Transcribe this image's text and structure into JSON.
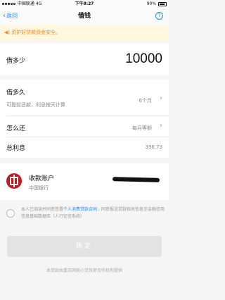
{
  "status_bar": {
    "carrier": "中国联通",
    "network": "4G",
    "time": "下午8:27",
    "battery": "90%",
    "battery_level": 0.9
  },
  "nav": {
    "back_label": "返回",
    "title": "借钱",
    "help_label": "?"
  },
  "notice": "资护好贷款资金安全。",
  "amount": {
    "label": "借多少",
    "value": "10000"
  },
  "duration": {
    "label": "借多久",
    "hint": "可提前还款，利息按天计算",
    "value": "6个月"
  },
  "repayment": {
    "label": "怎么还",
    "value": "每月等额"
  },
  "interest": {
    "label": "总利息",
    "value": "398.73"
  },
  "account": {
    "title": "收款账户",
    "bank_name": "中国银行"
  },
  "agreement": {
    "prefix": "本人已阅读并同意签署",
    "link": "个人消费贷款合同",
    "suffix": "，同意报送贷款相关信息至金融信用信息基础数据库（人行征信系统）"
  },
  "confirm_label": "确定",
  "footer_note": "本贷款由重庆网商小贷及其合作机构提供",
  "colors": {
    "accent": "#1a8cff",
    "notice_text": "#f08a24",
    "notice_bg": "#fff7e0",
    "bank_red": "#c8161d"
  },
  "icons": {
    "back": "chevron-left-icon",
    "help": "question-icon",
    "notice": "speaker-icon",
    "row_arrow": "chevron-right-icon",
    "bank": "bank-of-china-logo"
  }
}
